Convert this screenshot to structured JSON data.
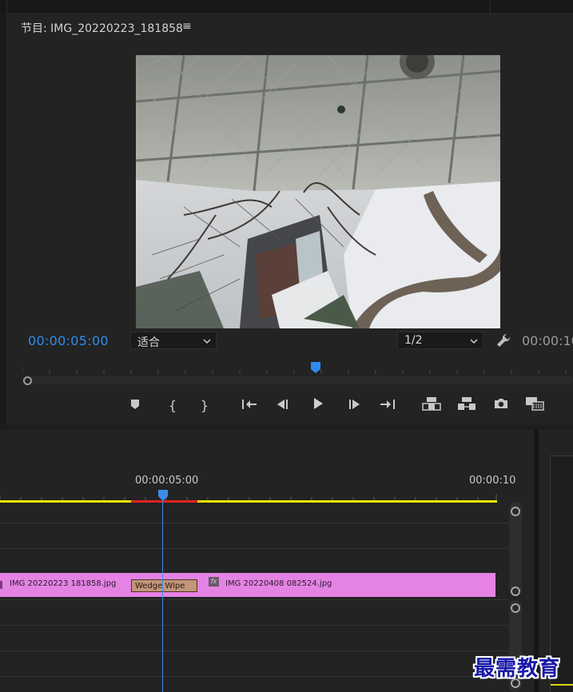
{
  "program_monitor": {
    "title": "节目: IMG_20220223_181858",
    "menu_icon": "≡",
    "current_timecode": "00:00:05:00",
    "end_timecode": "00:00:10",
    "zoom_select": {
      "value": "适合"
    },
    "resolution_select": {
      "value": "1/2"
    },
    "playhead_position_fraction": 0.5,
    "transport_icons": [
      "marker-icon",
      "in-point-icon",
      "out-point-icon",
      "go-to-in-icon",
      "step-back-icon",
      "play-icon",
      "step-forward-icon",
      "go-to-out-icon",
      "lift-icon",
      "extract-icon",
      "camera-icon",
      "compare-icon"
    ],
    "transport_glyphs": {
      "in_point": "{",
      "out_point": "}"
    }
  },
  "timeline": {
    "timecode_mid": "00:00:05:00",
    "timecode_end": "00:00:10",
    "clip_1_label": "IMG  20220223  181858.jpg",
    "transition_label": "Wedge Wipe",
    "fx_label": "fx",
    "clip_2_label": "IMG  20220408  082524.jpg",
    "colors": {
      "clip": "#e483e4",
      "transition": "#c3957a",
      "work_area": "#e8e800",
      "render_red": "#e02020",
      "playhead": "#3c8ce8",
      "timecode_blue": "#2d8ceb"
    }
  },
  "watermark": {
    "text": "最需教育"
  }
}
